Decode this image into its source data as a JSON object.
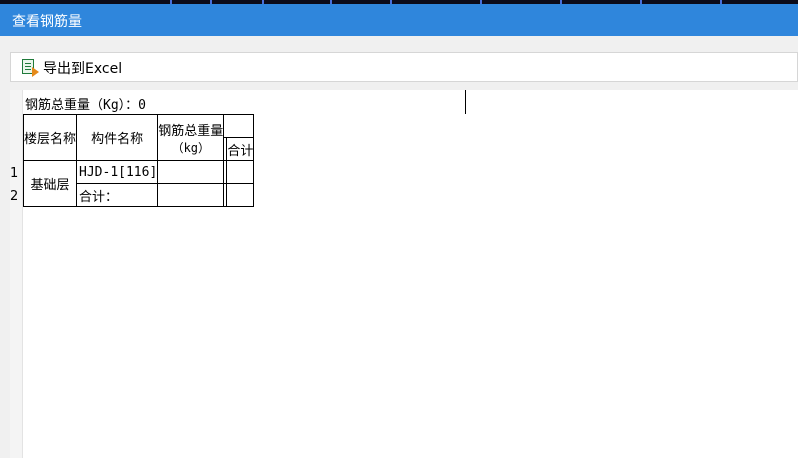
{
  "window": {
    "title": "查看钢筋量"
  },
  "toolbar": {
    "export_label": "导出到Excel"
  },
  "summary": {
    "label": "钢筋总重量",
    "unit_and_value": "（Kg）：0"
  },
  "table": {
    "headers": {
      "floor": "楼层名称",
      "component": "构件名称",
      "total_weight": "钢筋总重量",
      "total_weight_unit": "（kg）",
      "subtotal": "合计"
    },
    "row_numbers": [
      "1",
      "2"
    ],
    "rows": [
      {
        "floor": "基础层",
        "component": "HJD-1[116]",
        "weight": "",
        "col4": "",
        "subtotal": ""
      },
      {
        "component": "合计：",
        "weight": "",
        "col4": "",
        "subtotal": ""
      }
    ]
  }
}
